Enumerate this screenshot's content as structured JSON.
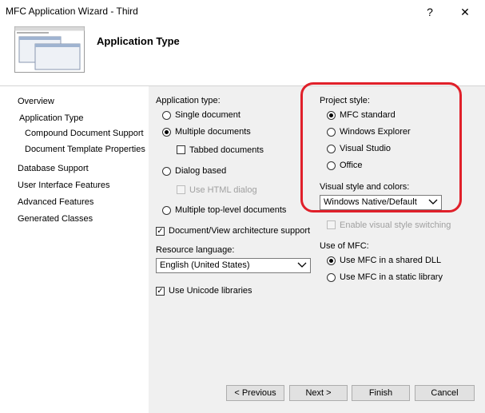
{
  "window": {
    "title": "MFC Application Wizard - Third",
    "help_glyph": "?",
    "close_glyph": "✕"
  },
  "header": {
    "page_title": "Application Type"
  },
  "nav": {
    "items": [
      {
        "label": "Overview"
      },
      {
        "label": "Application Type"
      },
      {
        "label": "Compound Document Support"
      },
      {
        "label": "Document Template Properties"
      },
      {
        "label": "Database Support"
      },
      {
        "label": "User Interface Features"
      },
      {
        "label": "Advanced Features"
      },
      {
        "label": "Generated Classes"
      }
    ]
  },
  "app_type": {
    "group_label": "Application type:",
    "single": "Single document",
    "multiple": "Multiple documents",
    "tabbed": "Tabbed documents",
    "dialog": "Dialog based",
    "html_dialog": "Use HTML dialog",
    "toplevel": "Multiple top-level documents",
    "selected": "Multiple documents"
  },
  "doc_view": {
    "label": "Document/View architecture support",
    "checked": true
  },
  "resource": {
    "label": "Resource language:",
    "value": "English (United States)"
  },
  "unicode": {
    "label": "Use Unicode libraries",
    "checked": true
  },
  "project_style": {
    "group_label": "Project style:",
    "mfc_standard": "MFC standard",
    "explorer": "Windows Explorer",
    "visual_studio": "Visual Studio",
    "office": "Office",
    "selected": "MFC standard"
  },
  "visual_style": {
    "label": "Visual style and colors:",
    "value": "Windows Native/Default",
    "switching": "Enable visual style switching"
  },
  "mfc_use": {
    "group_label": "Use of MFC:",
    "shared": "Use MFC in a shared DLL",
    "static": "Use MFC in a static library",
    "selected": "Use MFC in a shared DLL"
  },
  "buttons": {
    "previous": "< Previous",
    "next": "Next >",
    "finish": "Finish",
    "cancel": "Cancel"
  },
  "colors": {
    "annotation_ring": "#e0202a",
    "panel_bg": "#f0f0f0"
  }
}
